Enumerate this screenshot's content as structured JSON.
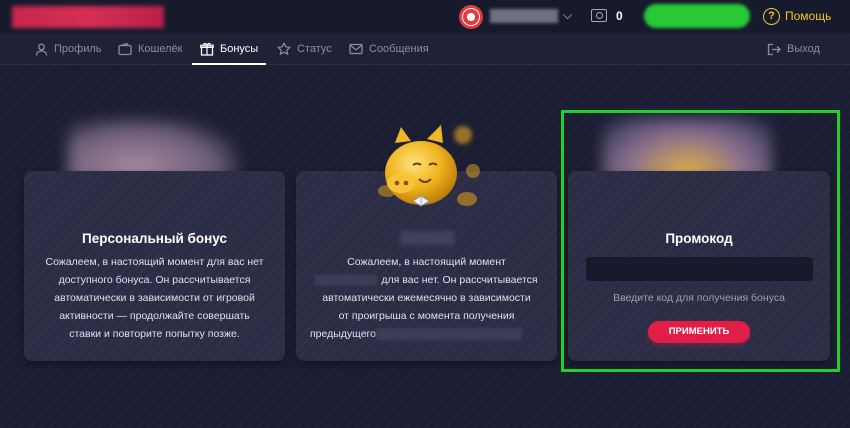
{
  "header": {
    "balance": "0",
    "help_label": "Помощь",
    "icons": {
      "chip": "casino-chip-icon",
      "wallet": "wallet-icon",
      "help": "question-circle-icon",
      "dropdown": "chevron-down-icon"
    },
    "colors": {
      "accent_green": "#27c935",
      "help_yellow": "#f2c81a"
    }
  },
  "nav": {
    "items": [
      {
        "label": "Профиль",
        "icon": "user-icon"
      },
      {
        "label": "Кошелёк",
        "icon": "wallet-icon"
      },
      {
        "label": "Бонусы",
        "icon": "gift-icon",
        "active": true
      },
      {
        "label": "Статус",
        "icon": "star-icon"
      },
      {
        "label": "Сообщения",
        "icon": "mail-icon"
      }
    ],
    "logout_label": "Выход"
  },
  "cards": {
    "personal": {
      "title": "Персональный бонус",
      "text": "Сожалеем, в настоящий момент для вас нет доступного бонуса. Он рассчитывается автоматически в зависимости от игровой активности — продолжайте совершать ставки и повторите попытку позже."
    },
    "cashback": {
      "text_line1": "Сожалеем, в настоящий момент",
      "text_line2": "для вас нет. Он рассчитывается",
      "text_line3": "автоматически ежемесячно в зависимости",
      "text_line4": "от проигрыша с момента получения",
      "text_line5": "предыдущего"
    },
    "promo": {
      "title": "Промокод",
      "input_placeholder": "",
      "hint": "Введите код для получения бонуса",
      "apply_label": "ПРИМЕНИТЬ"
    }
  },
  "colors": {
    "background": "#1b1d33",
    "card": "#2a2d45",
    "apply_button": "#e01e47",
    "highlight_border": "#22d02a"
  }
}
